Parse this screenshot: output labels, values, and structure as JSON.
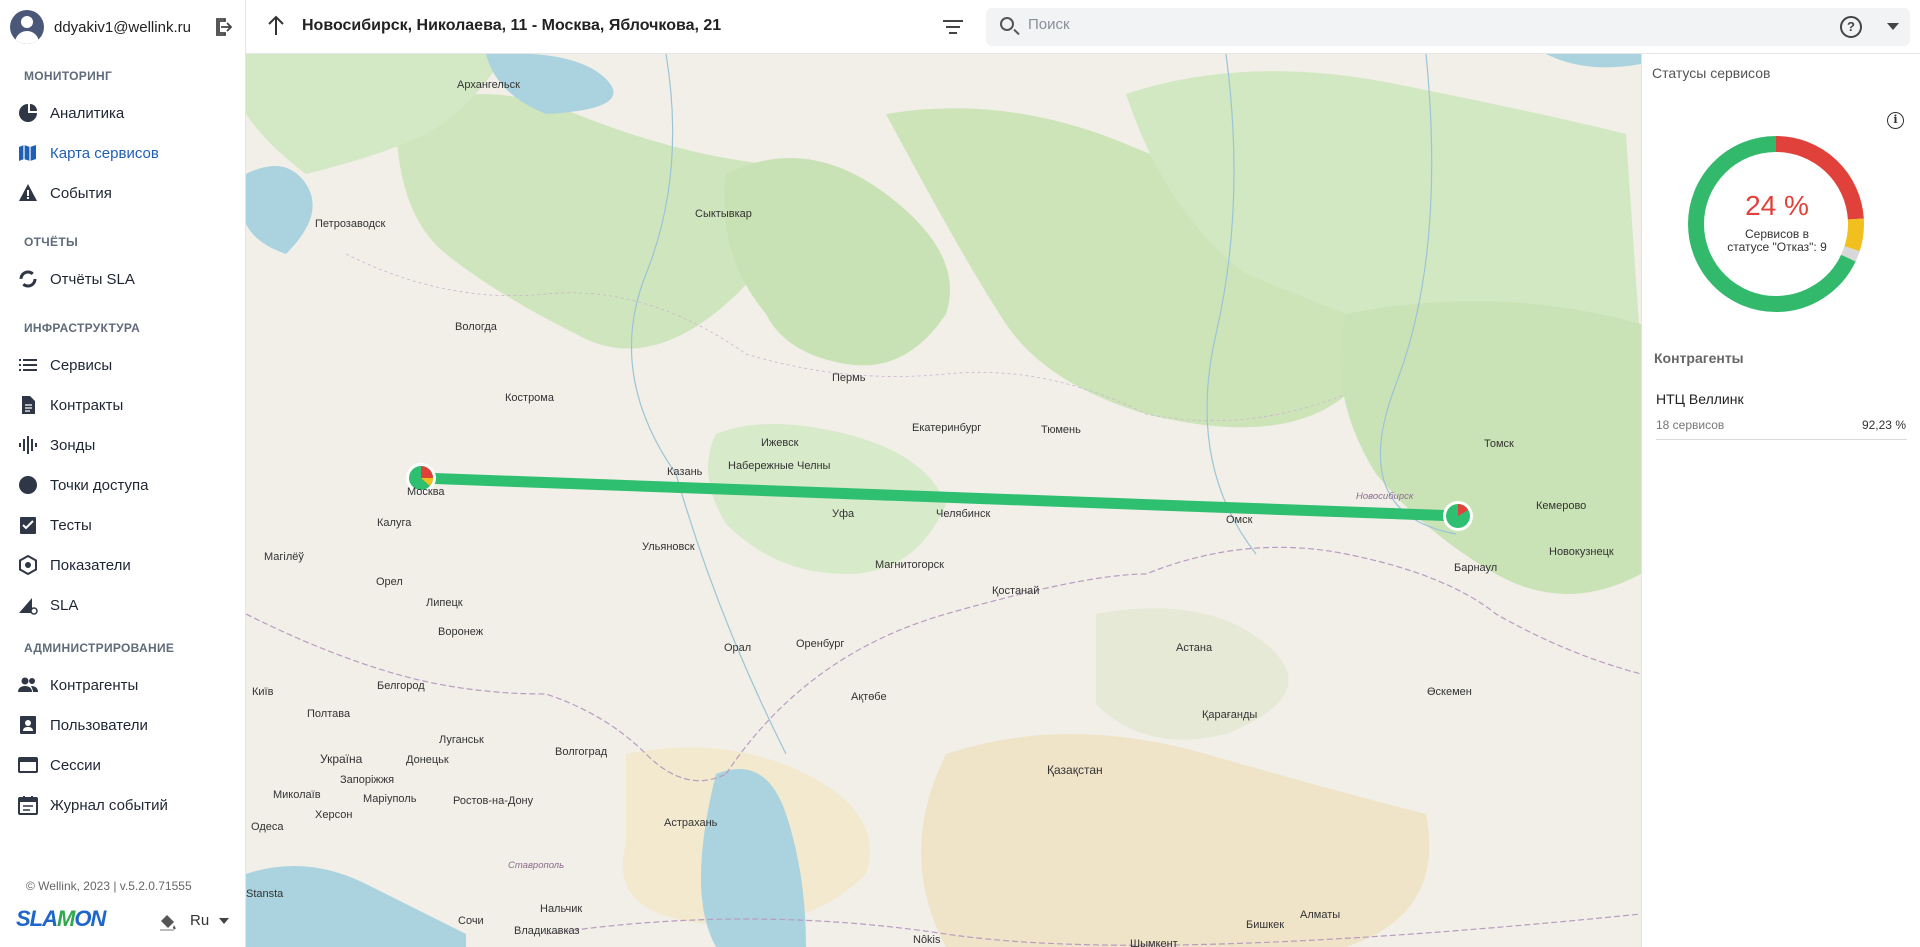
{
  "user": {
    "email": "ddyakiv1@wellink.ru"
  },
  "sidebar": {
    "sections": [
      {
        "title": "МОНИТОРИНГ"
      },
      {
        "title": "ОТЧЁТЫ"
      },
      {
        "title": "ИНФРАСТРУКТУРА"
      },
      {
        "title": "АДМИНИСТРИРОВАНИЕ"
      }
    ],
    "items": [
      {
        "label": "Аналитика",
        "icon": "pie-icon"
      },
      {
        "label": "Карта сервисов",
        "icon": "map-icon",
        "active": true
      },
      {
        "label": "События",
        "icon": "warning-icon"
      },
      {
        "label": "Отчёты SLA",
        "icon": "sync-icon"
      },
      {
        "label": "Сервисы",
        "icon": "list-icon"
      },
      {
        "label": "Контракты",
        "icon": "document-icon"
      },
      {
        "label": "Зонды",
        "icon": "signal-icon"
      },
      {
        "label": "Точки доступа",
        "icon": "circle-icon"
      },
      {
        "label": "Тесты",
        "icon": "checklist-icon"
      },
      {
        "label": "Показатели",
        "icon": "metrics-icon"
      },
      {
        "label": "SLA",
        "icon": "sla-icon"
      },
      {
        "label": "Контрагенты",
        "icon": "people-icon"
      },
      {
        "label": "Пользователи",
        "icon": "user-card-icon"
      },
      {
        "label": "Сессии",
        "icon": "window-icon"
      },
      {
        "label": "Журнал событий",
        "icon": "calendar-icon"
      }
    ],
    "footer": "© Wellink, 2023 | v.5.2.0.71555",
    "logo": {
      "part1": "SLA",
      "part2": "M",
      "part3": "ON"
    },
    "language": "Ru"
  },
  "header": {
    "title": "Новосибирск, Николаева, 11 - Москва, Яблочкова, 21",
    "search_placeholder": "Поиск",
    "help": "?"
  },
  "map": {
    "route_color": "#2fbf71",
    "cities": [
      "Архангельск",
      "Сыктывкар",
      "Петрозаводск",
      "Вологда",
      "Кострома",
      "Москва",
      "Казань",
      "Набережные Челны",
      "Ижевск",
      "Пермь",
      "Екатеринбург",
      "Тюмень",
      "Уфа",
      "Челябинск",
      "Омск",
      "Новосибирск",
      "Кемерово",
      "Томск",
      "Новокузнецк",
      "Барнаул",
      "Калуга",
      "Орел",
      "Липецк",
      "Воронеж",
      "Белгород",
      "Полтава",
      "Луганськ",
      "Донецьк",
      "Запоріжжя",
      "Миколаїв",
      "Херсон",
      "Одеса",
      "Маріуполь",
      "Ростов-на-Дону",
      "Волгоград",
      "Астрахань",
      "Ульяновск",
      "Магнитогорск",
      "Оренбург",
      "Орал",
      "Ақтөбе",
      "Қостанай",
      "Астана",
      "Қарағанды",
      "Өскемен",
      "Алматы",
      "Бишкек",
      "Қазақстан",
      "Нальчик",
      "Сочи",
      "Владикавказ",
      "Київ",
      "Магілёў",
      "Україна",
      "Nôkis",
      "Шымкент",
      "Ставрополь",
      "Stansta"
    ]
  },
  "panel": {
    "title": "Статусы сервисов",
    "percent": "24 %",
    "subtitle_line1": "Сервисов в",
    "subtitle_line2": "статусе \"Отказ\": 9",
    "donut": {
      "fail": 0.24,
      "warning": 0.06,
      "unknown": 0.02,
      "ok": 0.68
    },
    "colors": {
      "fail": "#e0413a",
      "warning": "#f2c01e",
      "unknown": "#d8d8d8",
      "ok": "#33b96c"
    },
    "contractors_title": "Контрагенты",
    "contractor": {
      "name": "НТЦ Веллинк",
      "count": "18 сервисов",
      "percent": "92,23 %"
    }
  }
}
